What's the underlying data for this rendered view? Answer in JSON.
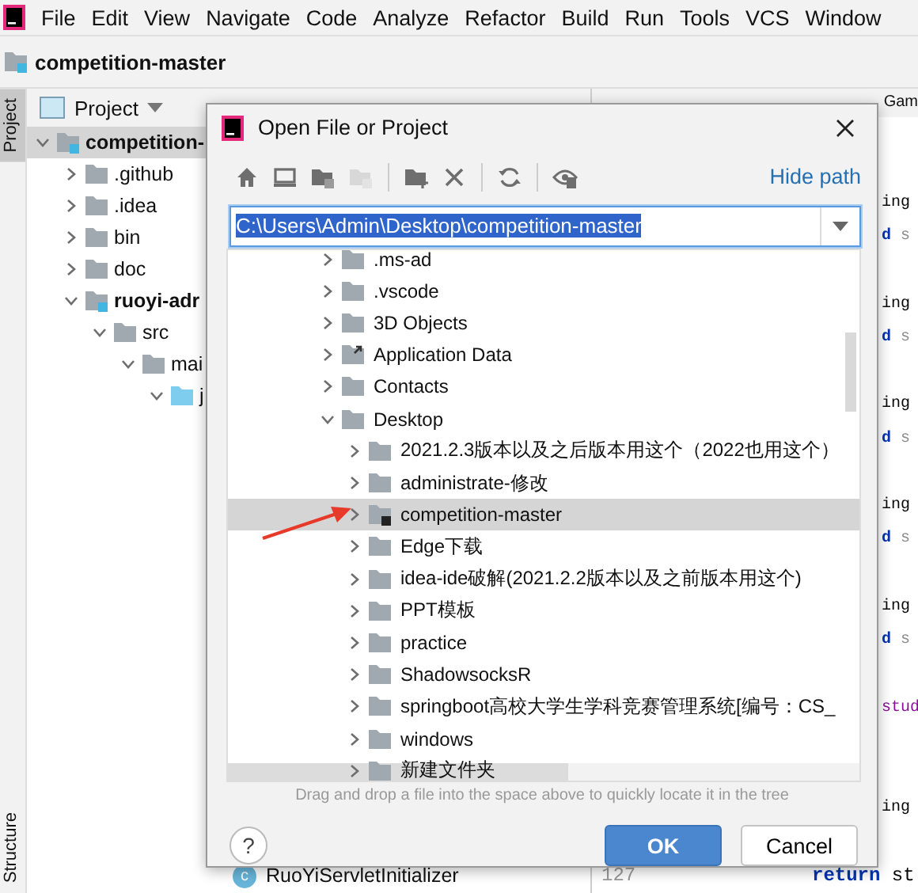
{
  "menu_bar": {
    "items": [
      "File",
      "Edit",
      "View",
      "Navigate",
      "Code",
      "Analyze",
      "Refactor",
      "Build",
      "Run",
      "Tools",
      "VCS",
      "Window"
    ]
  },
  "breadcrumb": {
    "title": "competition-master"
  },
  "tool_window_strip": {
    "tabs": [
      {
        "label": "Project",
        "selected": true
      }
    ],
    "bottom_tabs": [
      {
        "label": "Structure",
        "selected": false
      }
    ]
  },
  "project_panel": {
    "title": "Project",
    "tree": [
      {
        "label": "competition-",
        "kind": "module",
        "expanded": true,
        "children": [
          {
            "label": ".github",
            "kind": "folder",
            "expanded": false
          },
          {
            "label": ".idea",
            "kind": "folder",
            "expanded": false
          },
          {
            "label": "bin",
            "kind": "folder",
            "expanded": false
          },
          {
            "label": "doc",
            "kind": "folder",
            "expanded": false
          },
          {
            "label": "ruoyi-adr",
            "kind": "module",
            "expanded": true,
            "children": [
              {
                "label": "src",
                "kind": "folder",
                "expanded": true,
                "children": [
                  {
                    "label": "mai",
                    "kind": "folder",
                    "expanded": true,
                    "children": [
                      {
                        "label": "j",
                        "kind": "source",
                        "expanded": true
                      }
                    ]
                  }
                ]
              }
            ]
          }
        ]
      }
    ],
    "bottom_item": {
      "label": "RuoYiServletInitializer",
      "icon_letter": "c"
    }
  },
  "editor": {
    "tabs": [
      {
        "label": "Gam"
      }
    ],
    "lines": [
      {
        "kind": "fragment",
        "tokens": [
          {
            "kind": "plain",
            "text": "ing"
          }
        ]
      },
      {
        "kind": "fragment",
        "tokens": [
          {
            "kind": "keyword",
            "text": "d"
          },
          {
            "kind": "dim",
            "text": " s"
          }
        ]
      },
      {
        "kind": "blank"
      },
      {
        "kind": "fragment",
        "tokens": [
          {
            "kind": "plain",
            "text": "ing"
          }
        ]
      },
      {
        "kind": "fragment",
        "tokens": [
          {
            "kind": "keyword",
            "text": "d"
          },
          {
            "kind": "dim",
            "text": " s"
          }
        ]
      },
      {
        "kind": "blank"
      },
      {
        "kind": "fragment",
        "tokens": [
          {
            "kind": "plain",
            "text": "ing"
          }
        ]
      },
      {
        "kind": "fragment",
        "tokens": [
          {
            "kind": "keyword",
            "text": "d"
          },
          {
            "kind": "dim",
            "text": " s"
          }
        ]
      },
      {
        "kind": "blank"
      },
      {
        "kind": "fragment",
        "tokens": [
          {
            "kind": "plain",
            "text": "ing"
          }
        ]
      },
      {
        "kind": "fragment",
        "tokens": [
          {
            "kind": "keyword",
            "text": "d"
          },
          {
            "kind": "dim",
            "text": " s"
          }
        ]
      },
      {
        "kind": "blank"
      },
      {
        "kind": "fragment",
        "tokens": [
          {
            "kind": "plain",
            "text": "ing"
          }
        ]
      },
      {
        "kind": "fragment",
        "tokens": [
          {
            "kind": "keyword",
            "text": "d"
          },
          {
            "kind": "dim",
            "text": " s"
          }
        ]
      },
      {
        "kind": "blank"
      },
      {
        "kind": "fragment",
        "tokens": [
          {
            "kind": "field",
            "text": "stud"
          }
        ]
      },
      {
        "kind": "blank"
      },
      {
        "kind": "blank"
      },
      {
        "kind": "fragment",
        "tokens": [
          {
            "kind": "plain",
            "text": "ing"
          }
        ]
      },
      {
        "kind": "blank"
      },
      {
        "kind": "line",
        "number": "127",
        "tokens": [
          {
            "kind": "keyword",
            "text": "return"
          },
          {
            "kind": "plain",
            "text": " st"
          }
        ]
      }
    ]
  },
  "dialog": {
    "title": "Open File or Project",
    "toolbar": [
      {
        "kind": "home",
        "disabled": false
      },
      {
        "kind": "desktop",
        "disabled": false
      },
      {
        "kind": "project-folder",
        "disabled": false
      },
      {
        "kind": "module-folder",
        "disabled": true
      },
      {
        "kind": "sep"
      },
      {
        "kind": "new-folder",
        "disabled": false
      },
      {
        "kind": "delete",
        "disabled": false
      },
      {
        "kind": "sep"
      },
      {
        "kind": "refresh",
        "disabled": false
      },
      {
        "kind": "sep"
      },
      {
        "kind": "show-hidden",
        "disabled": false
      }
    ],
    "hide_path_link": "Hide path",
    "path": {
      "value": "C:\\Users\\Admin\\Desktop\\competition-master",
      "selected": true
    },
    "tree": [
      {
        "label": ".ms-ad",
        "kind": "folder",
        "expanded": false,
        "selected": false
      },
      {
        "label": ".vscode",
        "kind": "folder",
        "expanded": false,
        "selected": false
      },
      {
        "label": "3D Objects",
        "kind": "folder",
        "expanded": false,
        "selected": false
      },
      {
        "label": "Application Data",
        "kind": "link",
        "expanded": false,
        "selected": false
      },
      {
        "label": "Contacts",
        "kind": "folder",
        "expanded": false,
        "selected": false
      },
      {
        "label": "Desktop",
        "kind": "folder",
        "expanded": true,
        "selected": false,
        "children": [
          {
            "label": "2021.2.3版本以及之后版本用这个（2022也用这个）",
            "kind": "folder",
            "expanded": false,
            "selected": false
          },
          {
            "label": "administrate-修改",
            "kind": "folder",
            "expanded": false,
            "selected": false
          },
          {
            "label": "competition-master",
            "kind": "project",
            "expanded": false,
            "selected": true
          },
          {
            "label": "Edge下载",
            "kind": "folder",
            "expanded": false,
            "selected": false
          },
          {
            "label": "idea-ide破解(2021.2.2版本以及之前版本用这个)",
            "kind": "folder",
            "expanded": false,
            "selected": false
          },
          {
            "label": "PPT模板",
            "kind": "folder",
            "expanded": false,
            "selected": false
          },
          {
            "label": "practice",
            "kind": "folder",
            "expanded": false,
            "selected": false
          },
          {
            "label": "ShadowsocksR",
            "kind": "folder",
            "expanded": false,
            "selected": false
          },
          {
            "label": "springboot高校大学生学科竞赛管理系统[编号：CS_",
            "kind": "folder",
            "expanded": false,
            "selected": false
          },
          {
            "label": "windows",
            "kind": "folder",
            "expanded": false,
            "selected": false
          },
          {
            "label": "新建文件夹",
            "kind": "folder",
            "expanded": false,
            "selected": false
          }
        ]
      }
    ],
    "hint": "Drag and drop a file into the space above to quickly locate it in the tree",
    "help_label": "?",
    "buttons": [
      {
        "label": "OK",
        "kind": "primary"
      },
      {
        "label": "Cancel",
        "kind": "secondary"
      }
    ]
  }
}
